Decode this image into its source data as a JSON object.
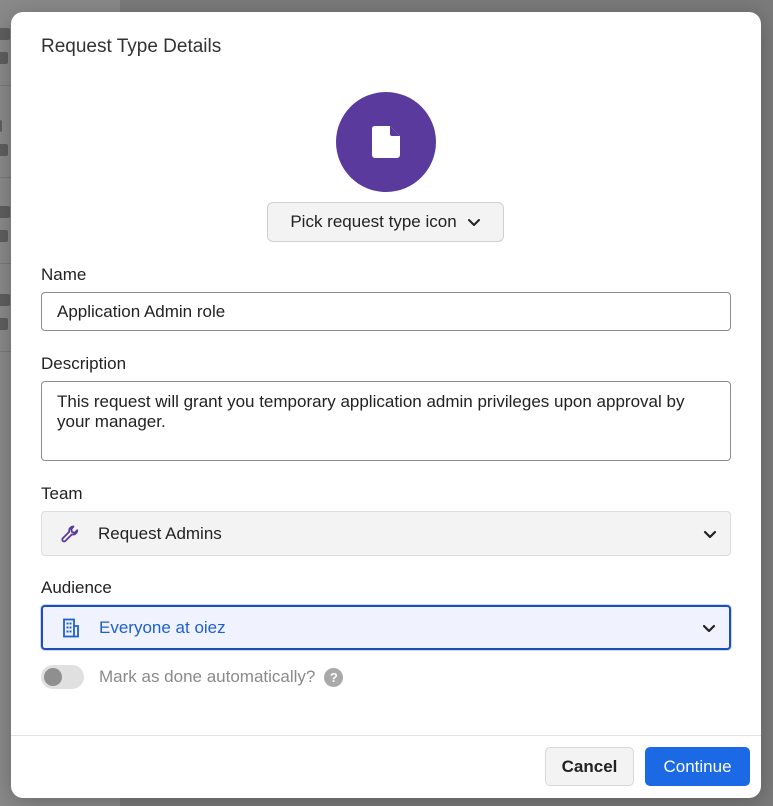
{
  "modal": {
    "title": "Request Type Details",
    "icon_picker_label": "Pick request type icon",
    "icon": "document-icon"
  },
  "form": {
    "name_label": "Name",
    "name_value": "Application Admin role",
    "description_label": "Description",
    "description_value": "This request will grant you temporary application admin privileges upon approval by your manager.",
    "team_label": "Team",
    "team_value": "Request Admins",
    "audience_label": "Audience",
    "audience_value": "Everyone at oiez",
    "auto_done_label": "Mark as done automatically?",
    "auto_done_enabled": false
  },
  "footer": {
    "cancel_label": "Cancel",
    "continue_label": "Continue"
  },
  "colors": {
    "avatar": "#5b3a9e",
    "primary": "#1c69e6",
    "audience_text": "#1f5fcf"
  }
}
